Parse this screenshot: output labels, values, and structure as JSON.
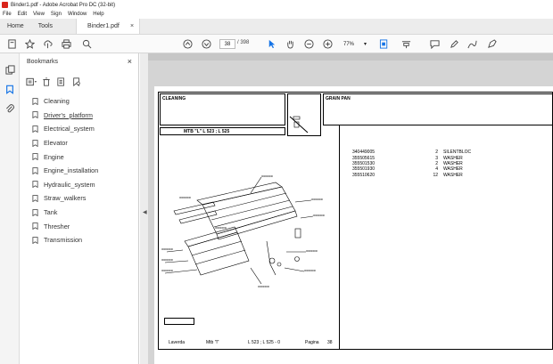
{
  "window": {
    "title": "Binder1.pdf - Adobe Acrobat Pro DC (32-bit)"
  },
  "menu": [
    "File",
    "Edit",
    "View",
    "Sign",
    "Window",
    "Help"
  ],
  "tabs": {
    "home": "Home",
    "tools": "Tools",
    "document": "Binder1.pdf",
    "close": "×"
  },
  "toolbar": {
    "page_current": "38",
    "page_total": "/  398",
    "zoom": "77%"
  },
  "bookmarks": {
    "title": "Bookmarks",
    "close": "×",
    "items": [
      {
        "label": "Cleaning"
      },
      {
        "label": "Driver's_platform"
      },
      {
        "label": "Electrical_system"
      },
      {
        "label": "Elevator"
      },
      {
        "label": "Engine"
      },
      {
        "label": "Engine_installation"
      },
      {
        "label": "Hydraulic_system"
      },
      {
        "label": "Straw_walkers"
      },
      {
        "label": "Tank"
      },
      {
        "label": "Thresher"
      },
      {
        "label": "Transmission"
      }
    ]
  },
  "page": {
    "left_title": "CLEANING",
    "model": "MTB \"L\"  L 523 ; L 525",
    "right_title": "GRAIN PAN",
    "parts": [
      {
        "code": "340449005",
        "qty": "2",
        "name": "SILENTBLOC"
      },
      {
        "code": "355505615",
        "qty": "3",
        "name": "WASHER"
      },
      {
        "code": "355501530",
        "qty": "2",
        "name": "WASHER"
      },
      {
        "code": "355501930",
        "qty": "4",
        "name": "WASHER"
      },
      {
        "code": "355510620",
        "qty": "12",
        "name": "WASHER"
      }
    ],
    "footer": {
      "brand": "Laverda",
      "model": "Mtb \"l\"",
      "series": "L 523 ; L 525 - 0",
      "page_label": "Pagina",
      "page_num": "38"
    }
  },
  "colors": {
    "accent": "#1473e6",
    "acrobat_red": "#d9251c"
  }
}
